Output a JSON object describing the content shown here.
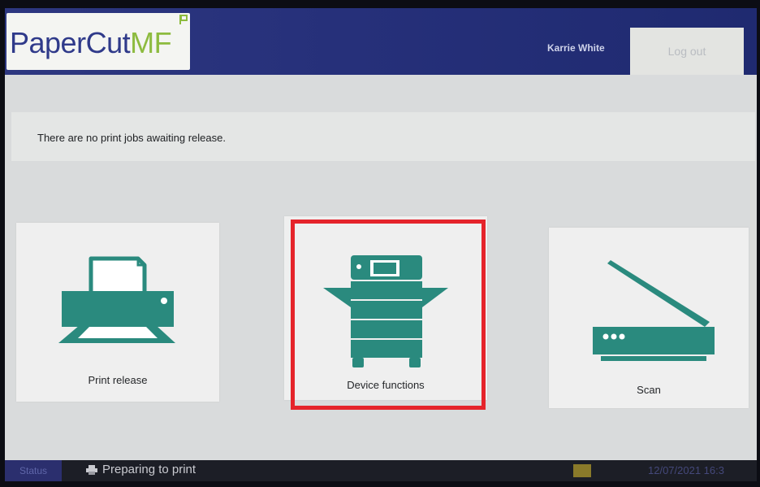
{
  "header": {
    "logo_primary": "PaperCut",
    "logo_secondary": "MF",
    "user_name": "Karrie White",
    "logout_label": "Log out"
  },
  "message": "There are no print jobs awaiting release.",
  "tiles": [
    {
      "label": "Print release",
      "icon": "printer-icon"
    },
    {
      "label": "Device functions",
      "icon": "copier-icon",
      "selected": true
    },
    {
      "label": "Scan",
      "icon": "scanner-icon"
    }
  ],
  "status_bar": {
    "tab_label": "Status",
    "status_text": "Preparing to print",
    "datetime": "12/07/2021 16:3"
  },
  "colors": {
    "brand_blue": "#2d3780",
    "brand_green": "#8dbb3f",
    "icon_teal": "#2a8a7e",
    "highlight_red": "#e5242b"
  }
}
